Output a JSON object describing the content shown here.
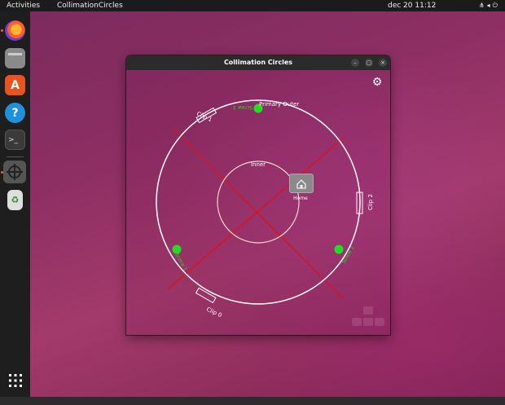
{
  "topbar": {
    "activities": "Activities",
    "app_name": "CollimationCircles",
    "clock": "dec 20  11:12",
    "tray_icons": [
      "network-icon",
      "volume-icon",
      "power-icon"
    ]
  },
  "dock": {
    "items": [
      "firefox",
      "files",
      "software-center",
      "help",
      "terminal",
      "collimation-circles",
      "trash",
      "show-apps"
    ]
  },
  "window": {
    "title": "Collimation Circles",
    "controls": {
      "minimize": "–",
      "maximize": "▢",
      "close": "×"
    },
    "labels": {
      "primary_outer": "Primary Outer",
      "inner": "Inner",
      "clip_0": "Clip 0",
      "clip_1": "Clip 1",
      "clip_2": "Clip 2",
      "screw_a": "Screw 3",
      "screw_b": "Screw 1",
      "screw_c": "Screw 2",
      "home": "Home"
    },
    "colors": {
      "circle": "#ffffff",
      "inner_circle": "#f0d9c8",
      "cross": "#d8151f",
      "screw": "#22dd22"
    }
  }
}
